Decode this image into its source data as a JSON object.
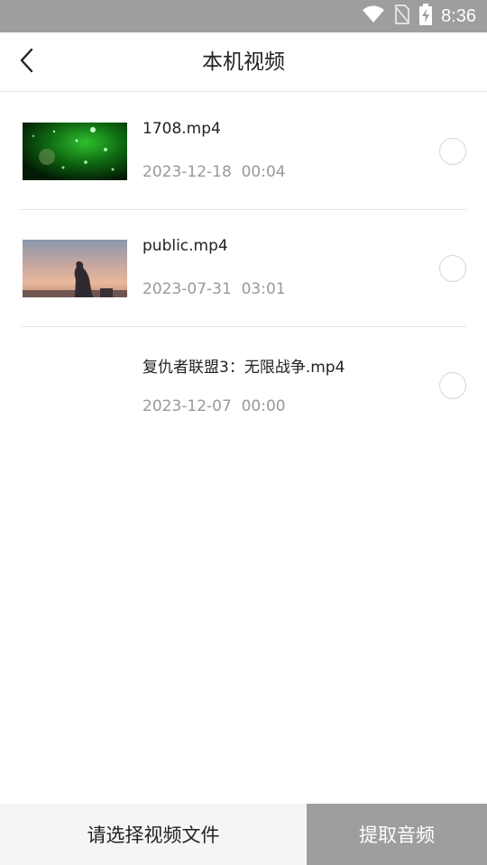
{
  "status_bar": {
    "time": "8:36",
    "icons": [
      "wifi-icon",
      "no-sim-icon",
      "battery-charging-icon"
    ]
  },
  "header": {
    "title": "本机视频",
    "back_icon": "chevron-left-icon"
  },
  "videos": [
    {
      "name": "1708.mp4",
      "date": "2023-12-18",
      "duration": "00:04",
      "thumbnail": "green-particles"
    },
    {
      "name": "public.mp4",
      "date": "2023-07-31",
      "duration": "03:01",
      "thumbnail": "silhouette-sunset"
    },
    {
      "name": "复仇者联盟3：无限战争.mp4",
      "date": "2023-12-07",
      "duration": "00:00",
      "thumbnail": "blank"
    }
  ],
  "footer": {
    "select_label": "请选择视频文件",
    "extract_button": "提取音频"
  },
  "colors": {
    "status_bar": "#9e9e9e",
    "extract_button_bg": "#9e9e9e",
    "select_bar_bg": "#f5f5f5",
    "meta_text": "#999999",
    "divider": "#e3e3e3"
  }
}
